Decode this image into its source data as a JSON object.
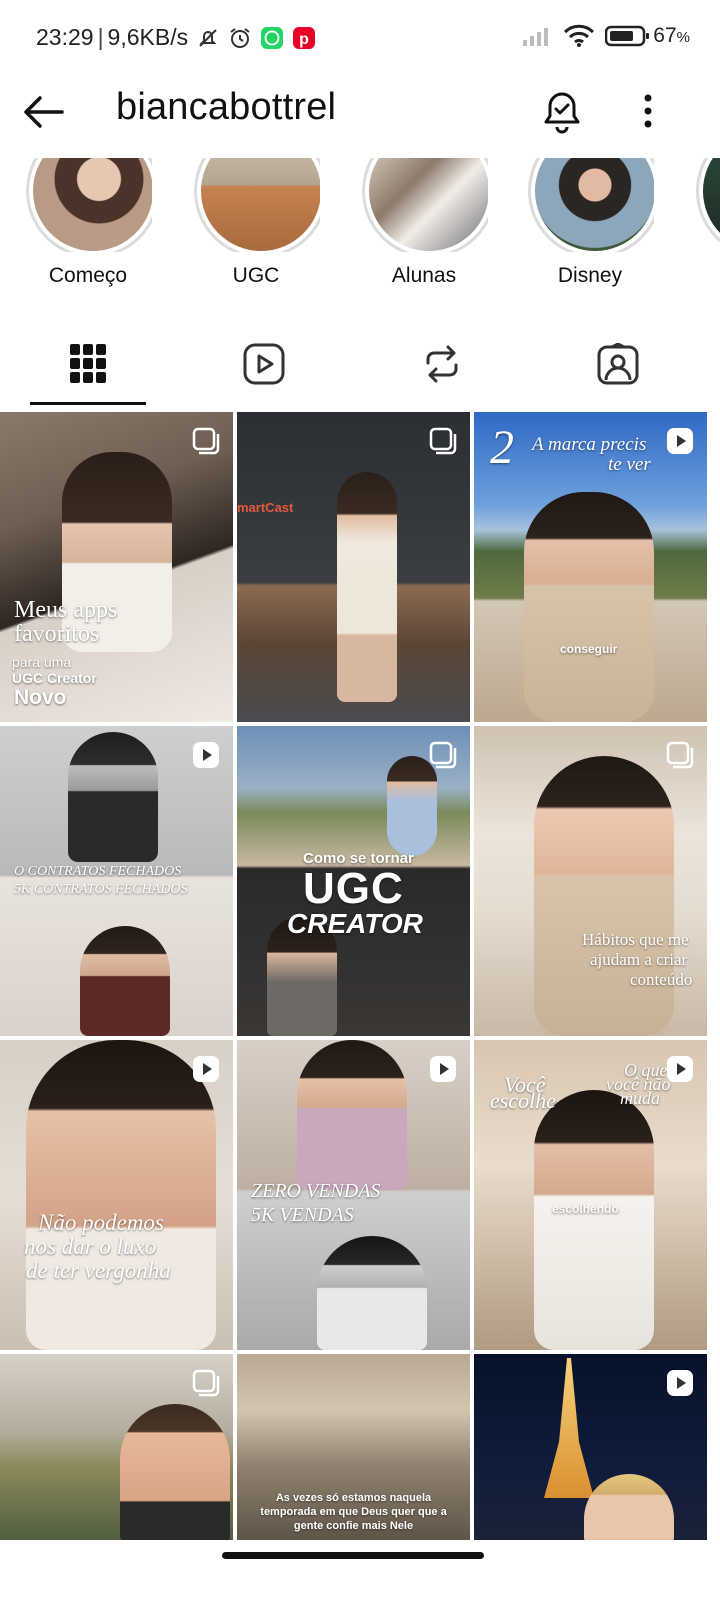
{
  "status_bar": {
    "time": "23:29",
    "speed": "9,6KB/s",
    "battery": "67",
    "battery_unit": "%"
  },
  "header": {
    "username": "biancabottrel",
    "icons": [
      "back-arrow-icon",
      "bell-check-icon",
      "more-vertical-icon"
    ]
  },
  "highlights": [
    {
      "label": "Começo"
    },
    {
      "label": "UGC"
    },
    {
      "label": "Alunas"
    },
    {
      "label": "Disney"
    }
  ],
  "tabs": [
    {
      "icon": "grid-icon",
      "active": true
    },
    {
      "icon": "reels-icon",
      "active": false
    },
    {
      "icon": "reposts-icon",
      "active": false
    },
    {
      "icon": "tagged-icon",
      "active": false
    }
  ],
  "posts": [
    {
      "type": "carousel",
      "text": {
        "l1": "Meus apps",
        "l2": "favoritos",
        "l3": "para uma",
        "l4": "UGC Creator",
        "l5": "Novo"
      }
    },
    {
      "type": "carousel",
      "text": {
        "l1": "martCast"
      }
    },
    {
      "type": "reel",
      "text": {
        "l1": "2",
        "l2": "A marca precis",
        "l3": "te ver",
        "l4": "conseguir"
      }
    },
    {
      "type": "reel",
      "text": {
        "l1": "O CONTRATOS FECHADOS",
        "l2": "5K CONTRATOS FECHADOS"
      }
    },
    {
      "type": "carousel",
      "text": {
        "l1": "Como se tornar",
        "l2": "UGC",
        "l3": "CREATOR"
      }
    },
    {
      "type": "carousel",
      "text": {
        "l1": "Hábitos que me",
        "l2": "ajudam a criar",
        "l3": "conteúdo"
      }
    },
    {
      "type": "reel",
      "text": {
        "l1": "Não podemos",
        "l2": "nos dar o luxo",
        "l3": "de ter vergonha"
      }
    },
    {
      "type": "reel",
      "text": {
        "l1": "ZERO VENDAS",
        "l2": "5K VENDAS"
      }
    },
    {
      "type": "reel",
      "text": {
        "l1": "Você",
        "l2": "escolhe",
        "l3": "O que",
        "l4": "você não",
        "l5": "muda",
        "l6": "escolhendo"
      }
    },
    {
      "type": "carousel",
      "text": {}
    },
    {
      "type": "none",
      "text": {
        "l1": "As vezes só estamos naquela",
        "l2": "temporada em que Deus quer que a",
        "l3": "gente confie mais Nele"
      }
    },
    {
      "type": "reel",
      "text": {}
    }
  ]
}
